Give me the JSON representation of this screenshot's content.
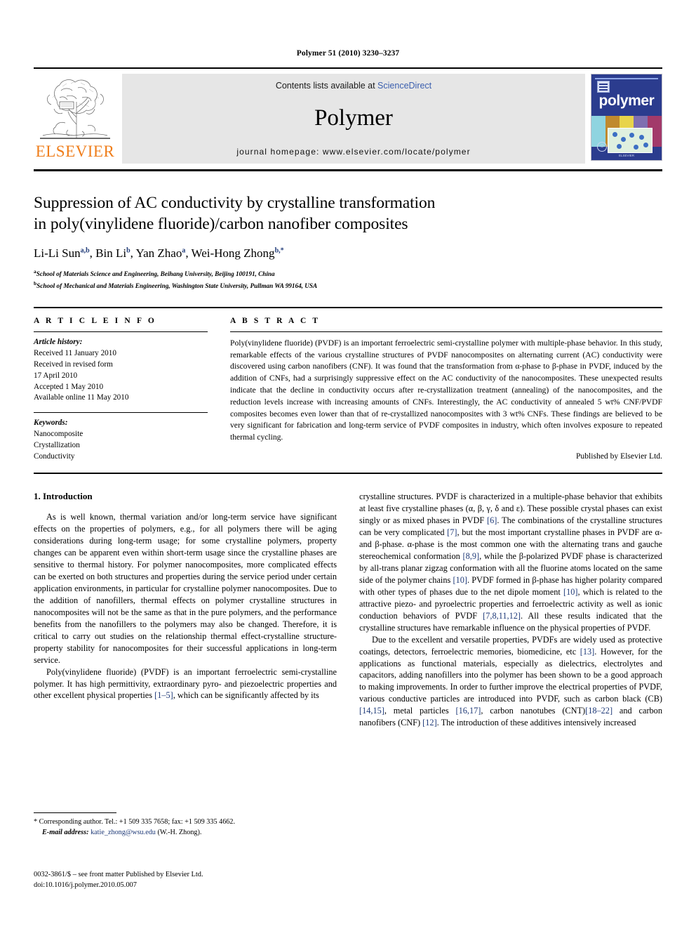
{
  "running_head": "Polymer 51 (2010) 3230–3237",
  "masthead": {
    "publisher_name": "ELSEVIER",
    "contents_prefix": "Contents lists available at ",
    "contents_link": "ScienceDirect",
    "journal_title": "Polymer",
    "homepage": "journal homepage: www.elsevier.com/locate/polymer",
    "cover_word": "polymer",
    "cover_footer": "ELSEVIER"
  },
  "article": {
    "title_line1": "Suppression of AC conductivity by crystalline transformation",
    "title_line2": "in poly(vinylidene fluoride)/carbon nanofiber composites",
    "authors": "Li-Li Sun a,b, Bin Li b, Yan Zhao a, Wei-Hong Zhong b,*",
    "authors_parts": [
      {
        "name": "Li-Li Sun",
        "sup": "a,b",
        "sep": ", "
      },
      {
        "name": "Bin Li",
        "sup": "b",
        "sep": ", "
      },
      {
        "name": "Yan Zhao",
        "sup": "a",
        "sep": ", "
      },
      {
        "name": "Wei-Hong Zhong",
        "sup": "b,*",
        "sep": ""
      }
    ],
    "affiliations": [
      {
        "marker": "a",
        "text": "School of Materials Science and Engineering, Beihang University, Beijing 100191, China"
      },
      {
        "marker": "b",
        "text": "School of Mechanical and Materials Engineering, Washington State University, Pullman WA 99164, USA"
      }
    ]
  },
  "article_info": {
    "heading": "A R T I C L E   I N F O",
    "history_label": "Article history:",
    "history": [
      "Received 11 January 2010",
      "Received in revised form",
      "17 April 2010",
      "Accepted 1 May 2010",
      "Available online 11 May 2010"
    ],
    "keywords_label": "Keywords:",
    "keywords": [
      "Nanocomposite",
      "Crystallization",
      "Conductivity"
    ]
  },
  "abstract": {
    "heading": "A B S T R A C T",
    "text": "Poly(vinylidene fluoride) (PVDF) is an important ferroelectric semi-crystalline polymer with multiple-phase behavior. In this study, remarkable effects of the various crystalline structures of PVDF nanocomposites on alternating current (AC) conductivity were discovered using carbon nanofibers (CNF). It was found that the transformation from α-phase to β-phase in PVDF, induced by the addition of CNFs, had a surprisingly suppressive effect on the AC conductivity of the nanocomposites. These unexpected results indicate that the decline in conductivity occurs after re-crystallization treatment (annealing) of the nanocomposites, and the reduction levels increase with increasing amounts of CNFs. Interestingly, the AC conductivity of annealed 5 wt% CNF/PVDF composites becomes even lower than that of re-crystallized nanocomposites with 3 wt% CNFs. These findings are believed to be very significant for fabrication and long-term service of PVDF composites in industry, which often involves exposure to repeated thermal cycling.",
    "publisher_line": "Published by Elsevier Ltd."
  },
  "introduction": {
    "heading": "1.  Introduction",
    "left_paragraphs": [
      "As is well known, thermal variation and/or long-term service have significant effects on the properties of polymers, e.g., for all polymers there will be aging considerations during long-term usage; for some crystalline polymers, property changes can be apparent even within short-term usage since the crystalline phases are sensitive to thermal history. For polymer nanocomposites, more complicated effects can be exerted on both structures and properties during the service period under certain application environments, in particular for crystalline polymer nanocomposites. Due to the addition of nanofillers, thermal effects on polymer crystalline structures in nanocomposites will not be the same as that in the pure polymers, and the performance benefits from the nanofillers to the polymers may also be changed. Therefore, it is critical to carry out studies on the relationship thermal effect-crystalline structure-property stability for nanocomposites for their successful applications in long-term service."
    ],
    "left_para2_pre": "Poly(vinylidene fluoride) (PVDF) is an important ferroelectric semi-crystalline polymer. It has high permittivity, extraordinary pyro- and piezoelectric properties and other excellent physical properties ",
    "left_para2_ref": "[1–5]",
    "left_para2_post": ", which can be significantly affected by its",
    "right_para1_segments": [
      {
        "t": "crystalline structures. PVDF is characterized in a multiple-phase behavior that exhibits at least five crystalline phases (α, β, γ, δ and ε). These possible crystal phases can exist singly or as mixed phases in PVDF "
      },
      {
        "t": "[6]",
        "ref": true
      },
      {
        "t": ". The combinations of the crystalline structures can be very complicated "
      },
      {
        "t": "[7]",
        "ref": true
      },
      {
        "t": ", but the most important crystalline phases in PVDF are α- and β-phase. α-phase is the most common one with the alternating trans and gauche stereochemical conformation "
      },
      {
        "t": "[8,9]",
        "ref": true
      },
      {
        "t": ", while the β-polarized PVDF phase is characterized by all-trans planar zigzag conformation with all the fluorine atoms located on the same side of the polymer chains "
      },
      {
        "t": "[10]",
        "ref": true
      },
      {
        "t": ". PVDF formed in β-phase has higher polarity compared with other types of phases due to the net dipole moment "
      },
      {
        "t": "[10]",
        "ref": true
      },
      {
        "t": ", which is related to the attractive piezo- and pyroelectric properties and ferroelectric activity as well as ionic conduction behaviors of PVDF "
      },
      {
        "t": "[7,8,11,12]",
        "ref": true
      },
      {
        "t": ". All these results indicated that the crystalline structures have remarkable influence on the physical properties of PVDF."
      }
    ],
    "right_para2_segments": [
      {
        "t": "Due to the excellent and versatile properties, PVDFs are widely used as protective coatings, detectors, ferroelectric memories, biomedicine, etc "
      },
      {
        "t": "[13]",
        "ref": true
      },
      {
        "t": ". However, for the applications as functional materials, especially as dielectrics, electrolytes and capacitors, adding nanofillers into the polymer has been shown to be a good approach to making improvements. In order to further improve the electrical properties of PVDF, various conductive particles are introduced into PVDF, such as carbon black (CB) "
      },
      {
        "t": "[14,15]",
        "ref": true
      },
      {
        "t": ", metal particles "
      },
      {
        "t": "[16,17]",
        "ref": true
      },
      {
        "t": ", carbon nanotubes (CNT)"
      },
      {
        "t": "[18–22]",
        "ref": true
      },
      {
        "t": " and carbon nanofibers (CNF) "
      },
      {
        "t": "[12]",
        "ref": true
      },
      {
        "t": ". The introduction of these additives intensively increased"
      }
    ]
  },
  "footnote": {
    "line1": "* Corresponding author. Tel.: +1 509 335 7658; fax: +1 509 335 4662.",
    "email_label": "E-mail address:",
    "email": "katie_zhong@wsu.edu",
    "email_suffix": " (W.-H. Zhong)."
  },
  "footer": {
    "line1": "0032-3861/$ – see front matter Published by Elsevier Ltd.",
    "line2": "doi:10.1016/j.polymer.2010.05.007"
  },
  "colors": {
    "link_blue": "#3b5fae",
    "ref_blue": "#1f3a78",
    "elsevier_orange": "#ef7d1a",
    "band_gray": "#e6e6e6",
    "cover_blue": "#2b3c8e"
  }
}
